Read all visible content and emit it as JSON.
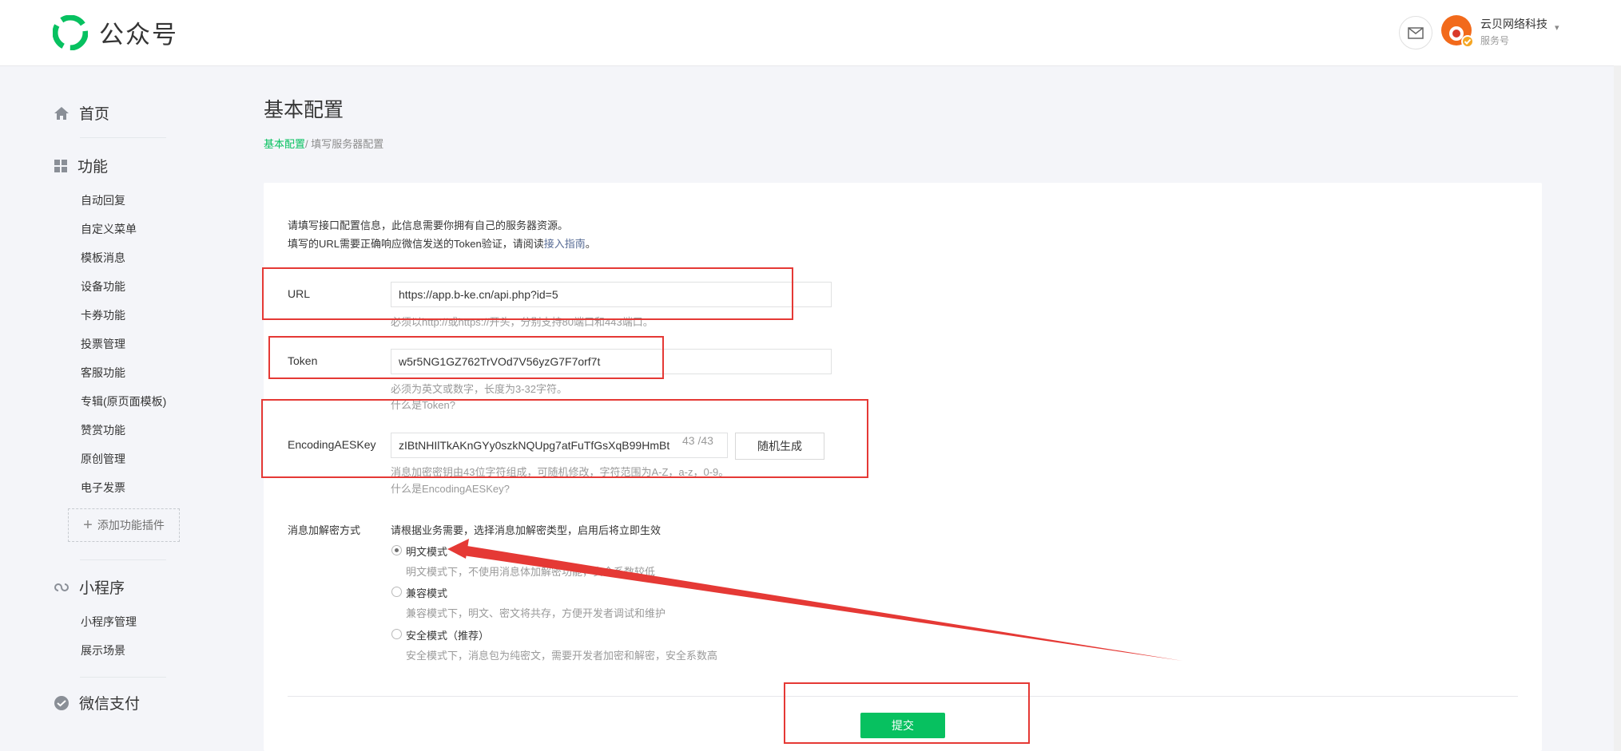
{
  "header": {
    "logo_text": "公众号",
    "account_name": "云贝网络科技",
    "account_type": "服务号",
    "caret": "⌄"
  },
  "sidebar": {
    "home": "首页",
    "features": "功能",
    "feature_items": [
      "自动回复",
      "自定义菜单",
      "模板消息",
      "设备功能",
      "卡券功能",
      "投票管理",
      "客服功能",
      "专辑(原页面模板)",
      "赞赏功能",
      "原创管理",
      "电子发票"
    ],
    "add_plugin": "添加功能插件",
    "miniprogram": "小程序",
    "miniprogram_items": [
      "小程序管理",
      "展示场景"
    ],
    "wechat_pay": "微信支付"
  },
  "page": {
    "title": "基本配置",
    "breadcrumb_active": "基本配置",
    "breadcrumb_rest": "/ 填写服务器配置"
  },
  "intro": {
    "line1": "请填写接口配置信息，此信息需要你拥有自己的服务器资源。",
    "line2_prefix": "填写的URL需要正确响应微信发送的Token验证，请阅读",
    "line2_link": "接入指南",
    "line2_suffix": "。"
  },
  "form": {
    "url_label": "URL",
    "url_value": "https://app.b-ke.cn/api.php?id=5",
    "url_hint": "必须以http://或https://开头，分别支持80端口和443端口。",
    "token_label": "Token",
    "token_value": "w5r5NG1GZ762TrVOd7V56yzG7F7orf7t",
    "token_hint": "必须为英文或数字，长度为3-32字符。",
    "token_link": "什么是Token?",
    "aes_label": "EncodingAESKey",
    "aes_value": "zIBtNHIlTkAKnGYy0szkNQUpg7atFuTfGsXqB99HmBt",
    "aes_counter": "43 /43",
    "aes_button": "随机生成",
    "aes_hint": "消息加密密钥由43位字符组成，可随机修改，字符范围为A-Z，a-z，0-9。",
    "aes_link": "什么是EncodingAESKey?",
    "mode_label": "消息加解密方式",
    "mode_intro": "请根据业务需要，选择消息加解密类型，启用后将立即生效",
    "modes": [
      {
        "label": "明文模式",
        "desc": "明文模式下，不使用消息体加解密功能，安全系数较低",
        "checked": true
      },
      {
        "label": "兼容模式",
        "desc": "兼容模式下，明文、密文将共存，方便开发者调试和维护",
        "checked": false
      },
      {
        "label": "安全模式（推荐）",
        "desc": "安全模式下，消息包为纯密文，需要开发者加密和解密，安全系数高",
        "checked": false
      }
    ],
    "submit": "提交"
  },
  "colors": {
    "brand_green": "#07c160",
    "link_blue": "#576b95",
    "annotation_red": "#e53935"
  }
}
